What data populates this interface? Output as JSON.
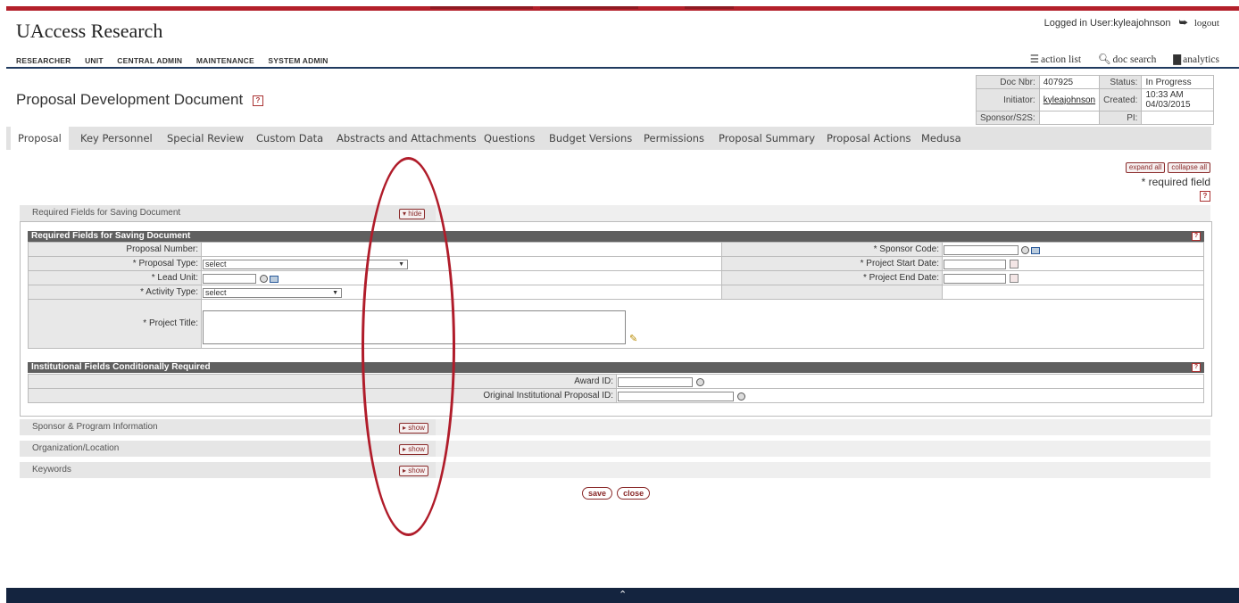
{
  "brand": "UAccess Research",
  "login": {
    "text": "Logged in User:kyleajohnson",
    "logout": "logout"
  },
  "main_nav": [
    "RESEARCHER",
    "UNIT",
    "CENTRAL ADMIN",
    "MAINTENANCE",
    "SYSTEM ADMIN"
  ],
  "tools": {
    "action_list": "action list",
    "doc_search": "doc search",
    "analytics": "analytics"
  },
  "doc_title": "Proposal Development Document",
  "doc_info": {
    "doc_nbr_label": "Doc Nbr:",
    "doc_nbr": "407925",
    "status_label": "Status:",
    "status": "In Progress",
    "initiator_label": "Initiator:",
    "initiator": "kyleajohnson",
    "created_label": "Created:",
    "created": "10:33 AM 04/03/2015",
    "sponsor_label": "Sponsor/S2S:",
    "sponsor": "",
    "pi_label": "PI:",
    "pi": ""
  },
  "tabs": [
    "Proposal",
    "Key Personnel",
    "Special Review",
    "Custom Data",
    "Abstracts and Attachments",
    "Questions",
    "Budget Versions",
    "Permissions",
    "Proposal Summary",
    "Proposal Actions",
    "Medusa"
  ],
  "active_tab": "Proposal",
  "expand_all": "expand all",
  "collapse_all": "collapse all",
  "required_note": "* required field",
  "required_section": {
    "title": "Required Fields for Saving Document",
    "toggle": "hide",
    "subheader": "Required Fields for Saving Document",
    "proposal_number_label": "Proposal Number:",
    "proposal_type_label": "* Proposal Type:",
    "proposal_type_value": "select",
    "lead_unit_label": "* Lead Unit:",
    "activity_type_label": "* Activity Type:",
    "activity_type_value": "select",
    "project_title_label": "* Project Title:",
    "sponsor_code_label": "* Sponsor Code:",
    "start_date_label": "* Project Start Date:",
    "end_date_label": "* Project End Date:"
  },
  "institutional_section": {
    "subheader": "Institutional Fields Conditionally Required",
    "award_id_label": "Award ID:",
    "orig_ip_label": "Original Institutional Proposal ID:"
  },
  "collapsed_sections": [
    {
      "title": "Sponsor & Program Information",
      "toggle": "show"
    },
    {
      "title": "Organization/Location",
      "toggle": "show"
    },
    {
      "title": "Keywords",
      "toggle": "show"
    }
  ],
  "buttons": {
    "save": "save",
    "close": "close"
  },
  "colors": {
    "brand_red": "#b3202a",
    "navy": "#14243f",
    "annotation": "#b01c2a"
  }
}
